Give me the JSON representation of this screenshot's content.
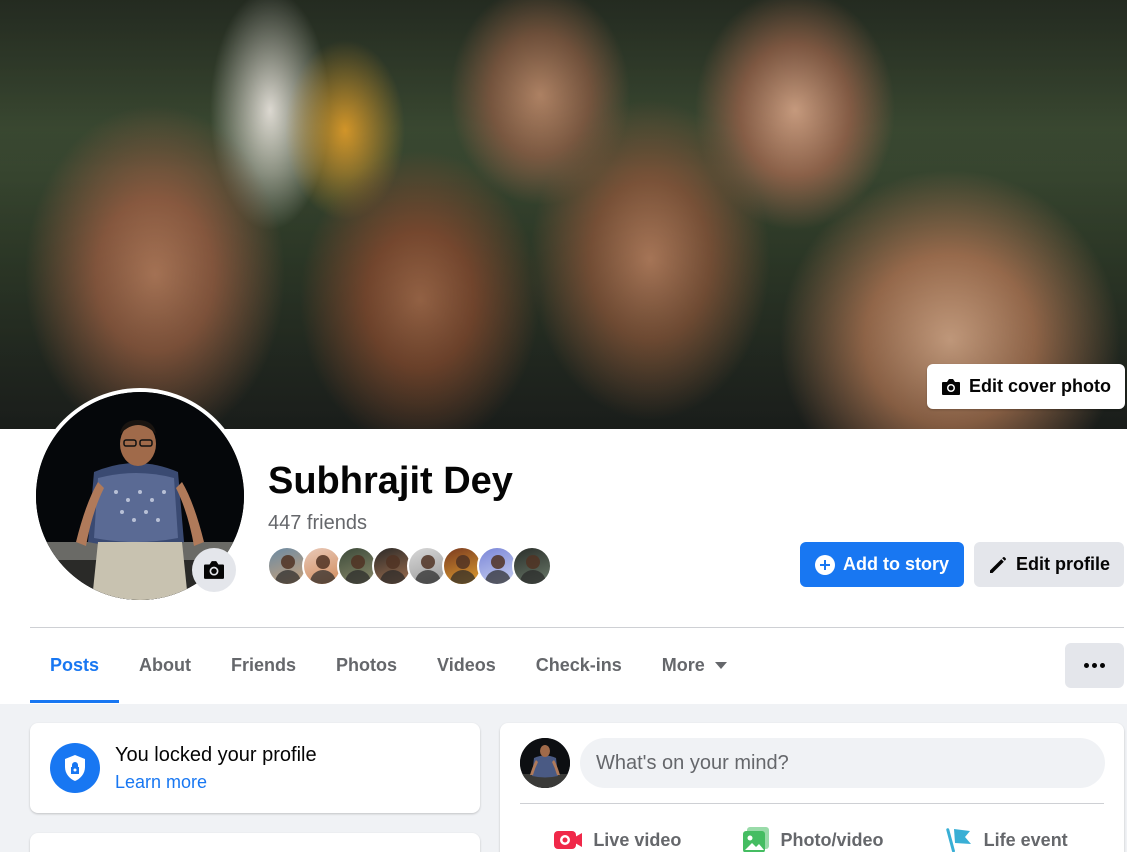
{
  "cover": {
    "edit_cover_label": "Edit cover photo",
    "icon": "camera-icon"
  },
  "profile": {
    "name": "Subhrajit Dey",
    "friends_count": "447 friends",
    "friend_faces": [
      {
        "colors": [
          "#6b8aa3",
          "#c9a27a"
        ]
      },
      {
        "colors": [
          "#e9c9b8",
          "#d08a5a"
        ]
      },
      {
        "colors": [
          "#3c4a3a",
          "#8a8a6a"
        ]
      },
      {
        "colors": [
          "#2c2a28",
          "#a07050"
        ]
      },
      {
        "colors": [
          "#d8d8d8",
          "#9a9a9a"
        ]
      },
      {
        "colors": [
          "#7a3a20",
          "#e0a030"
        ]
      },
      {
        "colors": [
          "#7a86d8",
          "#c8d0f0"
        ]
      },
      {
        "colors": [
          "#2a2e2a",
          "#6a7a6a"
        ]
      }
    ],
    "add_story_label": "Add to story",
    "edit_profile_label": "Edit profile"
  },
  "tabs": [
    {
      "label": "Posts",
      "active": true
    },
    {
      "label": "About"
    },
    {
      "label": "Friends"
    },
    {
      "label": "Photos"
    },
    {
      "label": "Videos"
    },
    {
      "label": "Check-ins"
    },
    {
      "label": "More"
    }
  ],
  "lock_card": {
    "title": "You locked your profile",
    "link": "Learn more"
  },
  "composer": {
    "placeholder": "What's on your mind?",
    "actions": [
      {
        "label": "Live video",
        "icon": "live-video-icon",
        "color": "#f02849"
      },
      {
        "label": "Photo/video",
        "icon": "photo-video-icon",
        "color": "#45bd62"
      },
      {
        "label": "Life event",
        "icon": "flag-icon",
        "color": "#39afd5"
      }
    ]
  },
  "colors": {
    "accent": "#1877f2",
    "background": "#f0f2f5",
    "secondary_text": "#65676b"
  }
}
